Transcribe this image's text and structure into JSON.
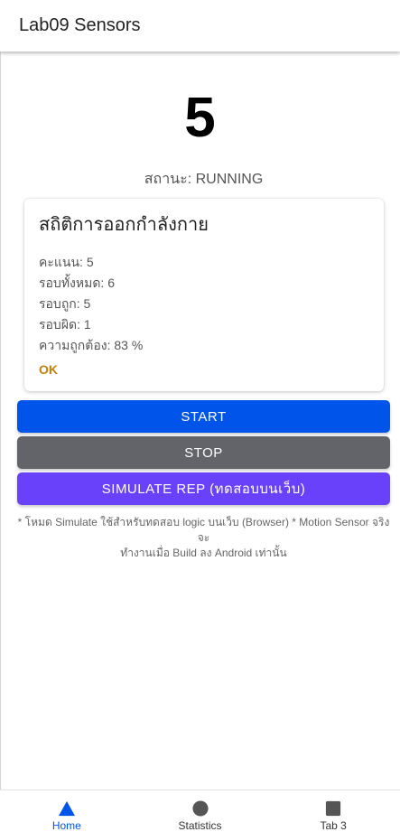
{
  "header": {
    "title": "Lab09 Sensors"
  },
  "counter": {
    "value": "5",
    "status": "สถานะ: RUNNING"
  },
  "card": {
    "title": "สถิติการออกกำลังกาย",
    "stats": [
      "คะแนน: 5",
      "รอบทั้งหมด: 6",
      "รอบถูก: 5",
      "รอบผิด: 1",
      "ความถูกต้อง: 83 %"
    ],
    "grade": "OK"
  },
  "buttons": {
    "start": "START",
    "stop": "STOP",
    "simulate": "SIMULATE REP (ทดสอบบนเว็บ)"
  },
  "note": {
    "line1": "* โหมด Simulate ใช้สำหรับทดสอบ logic บนเว็บ (Browser) * Motion Sensor จริงจะ",
    "line2": "ทำงานเมื่อ Build ลง Android เท่านั้น"
  },
  "tabs": [
    {
      "label": "Home",
      "icon": "triangle-icon",
      "active": true
    },
    {
      "label": "Statistics",
      "icon": "circle-icon",
      "active": false
    },
    {
      "label": "Tab 3",
      "icon": "square-icon",
      "active": false
    }
  ],
  "colors": {
    "start": "#0054e9",
    "stop": "#636469",
    "simulate": "#6a41fa",
    "grade": "#c5800a",
    "tab_active": "#0054e9",
    "tab_inactive": "#555555"
  }
}
